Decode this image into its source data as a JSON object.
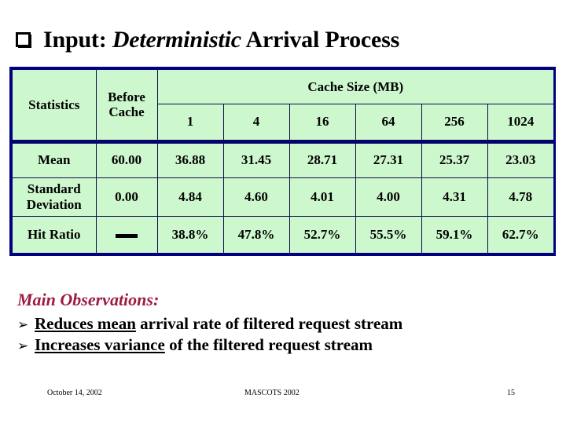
{
  "slide": {
    "bullet_icon": "hollow-square-shadow",
    "title_prefix": "Input: ",
    "title_emphasis": "Deterministic",
    "title_suffix": " Arrival Process"
  },
  "table": {
    "col_headers": {
      "statistics": "Statistics",
      "before_cache_line1": "Before",
      "before_cache_line2": "Cache",
      "group_header": "Cache Size (MB)"
    },
    "cache_sizes": [
      "1",
      "4",
      "16",
      "64",
      "256",
      "1024"
    ],
    "rows": [
      {
        "label": "Mean",
        "label_line2": "",
        "before_cache": "60.00",
        "values": [
          "36.88",
          "31.45",
          "28.71",
          "27.31",
          "25.37",
          "23.03"
        ]
      },
      {
        "label": "Standard",
        "label_line2": "Deviation",
        "before_cache": "0.00",
        "values": [
          "4.84",
          "4.60",
          "4.01",
          "4.00",
          "4.31",
          "4.78"
        ]
      },
      {
        "label": "Hit Ratio",
        "label_line2": "",
        "before_cache": "—",
        "values": [
          "38.8%",
          "47.8%",
          "52.7%",
          "55.5%",
          "59.1%",
          "62.7%"
        ]
      }
    ],
    "border_color": "#000080",
    "cell_bg": "#cdf7cd",
    "grid_color": "#0a0a4a"
  },
  "observations": {
    "heading": "Main Observations:",
    "heading_color": "#9E1B41",
    "bullet_icon": "arrowhead-right",
    "bullet_glyph": "➢",
    "items": [
      {
        "underlined": "Reduces mean",
        "rest": " arrival rate of filtered request stream"
      },
      {
        "underlined": "Increases variance",
        "rest": " of the filtered request stream"
      }
    ]
  },
  "footer": {
    "date": "October 14, 2002",
    "conference": "MASCOTS 2002",
    "page_number": "15"
  }
}
